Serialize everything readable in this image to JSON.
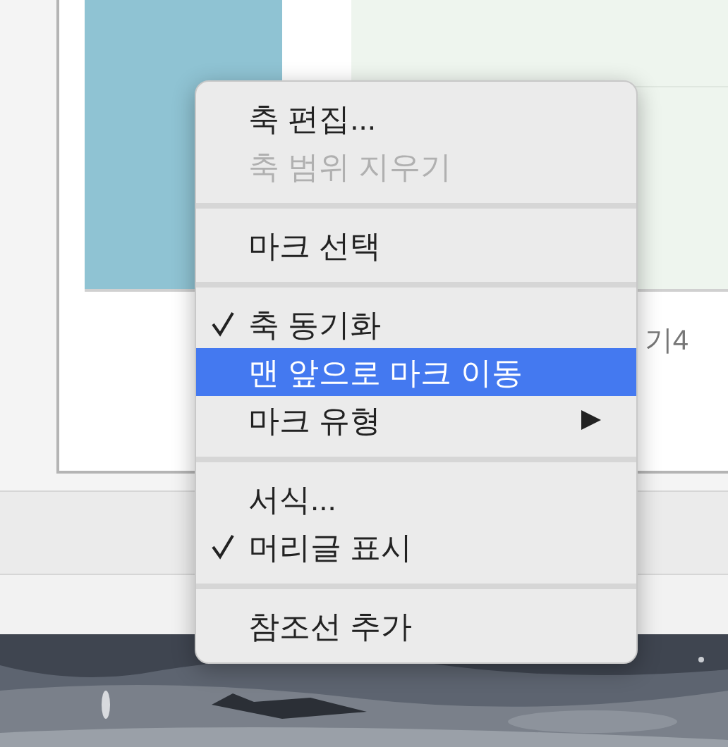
{
  "chart": {
    "axis_label": "기4"
  },
  "context_menu": {
    "items": [
      {
        "kind": "item",
        "label": "축 편집...",
        "disabled": false,
        "checked": false,
        "selected": false,
        "submenu": false
      },
      {
        "kind": "item",
        "label": "축 범위 지우기",
        "disabled": true,
        "checked": false,
        "selected": false,
        "submenu": false
      },
      {
        "kind": "separator"
      },
      {
        "kind": "item",
        "label": "마크 선택",
        "disabled": false,
        "checked": false,
        "selected": false,
        "submenu": false
      },
      {
        "kind": "separator"
      },
      {
        "kind": "item",
        "label": "축 동기화",
        "disabled": false,
        "checked": true,
        "selected": false,
        "submenu": false
      },
      {
        "kind": "item",
        "label": "맨 앞으로 마크 이동",
        "disabled": false,
        "checked": false,
        "selected": true,
        "submenu": false
      },
      {
        "kind": "item",
        "label": "마크 유형",
        "disabled": false,
        "checked": false,
        "selected": false,
        "submenu": true
      },
      {
        "kind": "separator"
      },
      {
        "kind": "item",
        "label": "서식...",
        "disabled": false,
        "checked": false,
        "selected": false,
        "submenu": false
      },
      {
        "kind": "item",
        "label": "머리글 표시",
        "disabled": false,
        "checked": true,
        "selected": false,
        "submenu": false
      },
      {
        "kind": "separator"
      },
      {
        "kind": "item",
        "label": "참조선 추가",
        "disabled": false,
        "checked": false,
        "selected": false,
        "submenu": false
      }
    ]
  }
}
